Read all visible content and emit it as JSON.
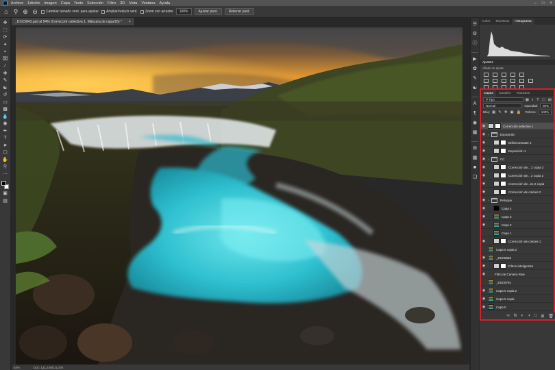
{
  "menu": {
    "items": [
      "Archivo",
      "Edición",
      "Imagen",
      "Capa",
      "Texto",
      "Selección",
      "Filtro",
      "3D",
      "Vista",
      "Ventana",
      "Ayuda"
    ]
  },
  "options": {
    "cambiar_tamano": "Cambiar tamaño vent. para ajustar",
    "ampliar_reducir": "Ampliar/reducir vent.",
    "zoom_arrastre": "Zoom con arrastre",
    "zoom_value": "100%",
    "ajustar_label": "Ajustar pant.",
    "rellenar_label": "Rellenar pant."
  },
  "document": {
    "tab_title": "_DSC5843.psd al 54% (Corrección selectiva 1, Máscara de capa/16) *",
    "close_glyph": "×"
  },
  "status": {
    "zoom": "54%",
    "doc_size": "Doc: 121,4 M/1.5,3 M"
  },
  "panels": {
    "top_tabs": [
      "Color",
      "Muestras",
      "Histograma"
    ],
    "top_active": "Histograma",
    "adjust_title": "Ajustes",
    "adjust_sub": "Añadir un ajuste",
    "layer_tabs": [
      "Capas",
      "Canales",
      "Trazados"
    ],
    "layer_active": "Capas",
    "filter_kind": "Tipo",
    "blend_mode": "Normal",
    "opacity_label": "Opacidad:",
    "opacity_value": "50%",
    "lock_label": "Bloq:",
    "fill_label": "Relleno:",
    "fill_value": "100%"
  },
  "layers": [
    {
      "name": "Corrección selectiva 1",
      "thumb": "adj",
      "indent": 0,
      "eye": true,
      "active": true
    },
    {
      "name": "Exposición",
      "thumb": "folder",
      "indent": 0,
      "eye": true
    },
    {
      "name": "Brillo/contraste 1",
      "thumb": "adj",
      "indent": 1,
      "eye": true
    },
    {
      "name": "Exposición 1",
      "thumb": "adj",
      "indent": 1,
      "eye": true
    },
    {
      "name": "CC",
      "thumb": "folder",
      "indent": 0,
      "eye": true
    },
    {
      "name": "Corrección de... 2 copia 3",
      "thumb": "adj",
      "indent": 1,
      "eye": true
    },
    {
      "name": "Corrección de... 2 copia 2",
      "thumb": "adj",
      "indent": 1,
      "eye": true
    },
    {
      "name": "Corrección de...es 2 copia",
      "thumb": "adj",
      "indent": 1,
      "eye": true
    },
    {
      "name": "Corrección de colores 2",
      "thumb": "adj",
      "indent": 1,
      "eye": true
    },
    {
      "name": "Retoque",
      "thumb": "folder",
      "indent": 0,
      "eye": true
    },
    {
      "name": "Capa 4",
      "thumb": "black",
      "indent": 1,
      "eye": true
    },
    {
      "name": "Capa 3",
      "thumb": "photo",
      "indent": 1,
      "eye": true
    },
    {
      "name": "Capa 2",
      "thumb": "photo",
      "indent": 1,
      "eye": true
    },
    {
      "name": "Capa 1",
      "thumb": "photo",
      "indent": 1,
      "eye": false
    },
    {
      "name": "Corrección de colores 1",
      "thumb": "adj",
      "indent": 1,
      "eye": true
    },
    {
      "name": "Capa 0 copia 2",
      "thumb": "photo",
      "indent": 0,
      "eye": false
    },
    {
      "name": "_DSC5833",
      "thumb": "photo",
      "indent": 0,
      "eye": true
    },
    {
      "name": "Filtros inteligentes",
      "thumb": "adj",
      "indent": 1,
      "eye": true
    },
    {
      "name": "Filtro de Camera Raw",
      "thumb": "none",
      "indent": 1,
      "eye": true
    },
    {
      "name": "_DSC5791",
      "thumb": "photo",
      "indent": 0,
      "eye": false
    },
    {
      "name": "Capa 0 copia 2",
      "thumb": "photo",
      "indent": 0,
      "eye": true
    },
    {
      "name": "Capa 0 copia",
      "thumb": "photo",
      "indent": 0,
      "eye": true
    },
    {
      "name": "Capa 0",
      "thumb": "photo",
      "indent": 0,
      "eye": true
    }
  ],
  "icons": {
    "toolbar": [
      "move-icon",
      "marquee-icon",
      "lasso-icon",
      "quick-select-icon",
      "crop-icon",
      "frame-icon",
      "eyedropper-icon",
      "healing-icon",
      "brush-icon",
      "stamp-icon",
      "history-brush-icon",
      "eraser-icon",
      "gradient-icon",
      "blur-icon",
      "dodge-icon",
      "pen-icon",
      "type-icon",
      "path-select-icon",
      "shape-icon",
      "hand-icon",
      "zoom-icon",
      "more-icon"
    ]
  },
  "colors": {
    "highlight_border": "#d6202a",
    "panel_bg": "#383838",
    "app_bg": "#282828"
  }
}
